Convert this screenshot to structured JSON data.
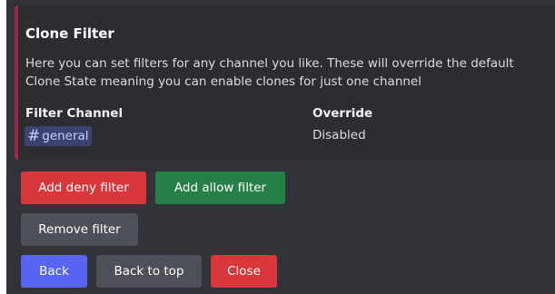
{
  "embed": {
    "accent_color": "#a3234a",
    "title": "Clone Filter",
    "description_lines": [
      "Here you can set filters for any channel you like. These will override the default",
      "Clone State meaning you can enable clones for just one channel"
    ],
    "fields": [
      {
        "name": "Filter Channel",
        "value": "general",
        "value_prefix": "#"
      },
      {
        "name": "Override",
        "value": "Disabled"
      }
    ]
  },
  "buttons": {
    "row1": [
      {
        "label": "Add deny filter",
        "color": "#da373c"
      },
      {
        "label": "Add allow filter",
        "color": "#248046"
      }
    ],
    "row2": [
      {
        "label": "Remove filter",
        "color": "#4e5058"
      }
    ],
    "row3": [
      {
        "label": "Back",
        "color": "#5865f2"
      },
      {
        "label": "Back to top",
        "color": "#4e5058"
      },
      {
        "label": "Close",
        "color": "#da373c"
      }
    ]
  }
}
